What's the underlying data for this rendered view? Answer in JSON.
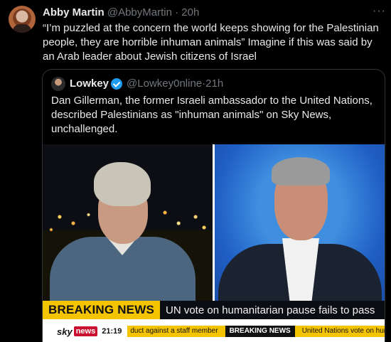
{
  "tweet": {
    "author_name": "Abby Martin",
    "author_handle": "@AbbyMartin",
    "separator": "·",
    "timestamp": "20h",
    "more_icon": "more-horizontal-icon",
    "text": "“I’m puzzled at the concern the world keeps showing for the Palestinian people, they are horrible inhuman animals” Imagine if this was said by an Arab leader about Jewish citizens of Israel"
  },
  "quoted_tweet": {
    "author_name": "Lowkey",
    "author_handle": "@Lowkey0nline",
    "separator": "·",
    "timestamp": "21h",
    "verified_icon": "verified-badge-icon",
    "text": "Dan Gillerman, the former Israeli ambassador to the United Nations, described Palestinians as \"inhuman animals\" on Sky News, unchallenged."
  },
  "media": {
    "breaking_label": "BREAKING NEWS",
    "headline": "UN vote on humanitarian pause fails to pass",
    "channel_name": "sky",
    "channel_badge": "news",
    "clock": "21:19",
    "crawl_lead": "duct against a staff member",
    "crawl_tag": "BREAKING NEWS",
    "crawl_tail": "United Nations vote on humanitar"
  },
  "colors": {
    "background": "#000000",
    "primary_text": "#e7e9ea",
    "secondary_text": "#71767b",
    "verified_blue": "#1d9bf0",
    "breaking_yellow": "#f5c400"
  }
}
